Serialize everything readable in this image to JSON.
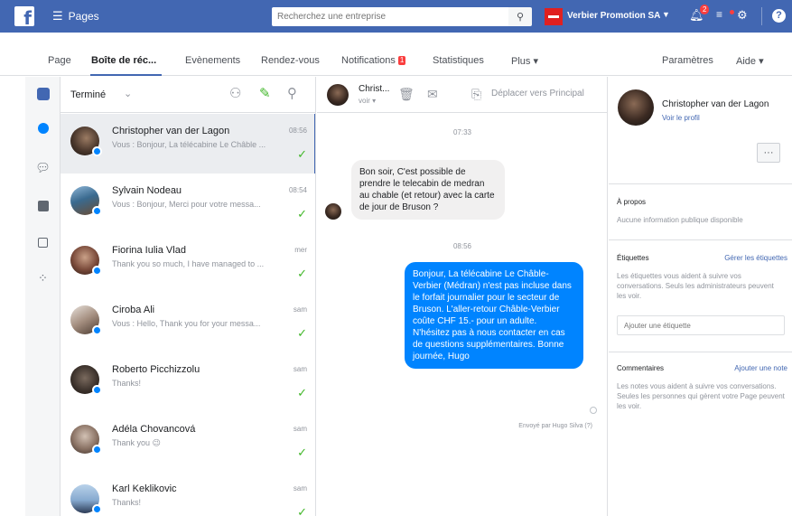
{
  "topbar": {
    "pages_label": "Pages",
    "search_placeholder": "Recherchez une entreprise",
    "page_name": "Verbier Promotion SA",
    "notif_count": "2",
    "help_icon": "question-icon"
  },
  "tabs": [
    {
      "label": "Page"
    },
    {
      "label": "Boîte de réc..."
    },
    {
      "label": "Evènements"
    },
    {
      "label": "Rendez-vous"
    },
    {
      "label": "Notifications"
    },
    {
      "label": "Statistiques"
    },
    {
      "label": "Plus ▾"
    },
    {
      "label": "Paramètres"
    },
    {
      "label": "Aide ▾"
    }
  ],
  "tab_notif_badge": "1",
  "list": {
    "filter_label": "Terminé",
    "conversations": [
      {
        "name": "Christopher van der Lagon",
        "preview": "Vous : Bonjour, La télécabine Le Châble ...",
        "time": "08:56"
      },
      {
        "name": "Sylvain Nodeau",
        "preview": "Vous : Bonjour, Merci pour votre messa...",
        "time": "08:54"
      },
      {
        "name": "Fiorina Iulia Vlad",
        "preview": "Thank you so much, I have managed to ...",
        "time": "mer"
      },
      {
        "name": "Ciroba Ali",
        "preview": "Vous : Hello, Thank you for your messa...",
        "time": "sam"
      },
      {
        "name": "Roberto Picchizzolu",
        "preview": "Thanks!",
        "time": "sam"
      },
      {
        "name": "Adéla Chovancová",
        "preview": "Thank you 😉",
        "time": "sam"
      },
      {
        "name": "Karl Keklikovic",
        "preview": "Thanks!",
        "time": "sam"
      }
    ]
  },
  "chat": {
    "contact_name": "Christ...",
    "contact_sub": "voir ▾",
    "move_label": "Déplacer vers Principal",
    "time1": "07:33",
    "incoming": "Bon soir, C'est possible de prendre le telecabin de medran au chable (et retour) avec la carte de jour de Bruson ?",
    "time2": "08:56",
    "outgoing": "Bonjour, La télécabine Le Châble-Verbier (Médran) n'est pas incluse dans le forfait journalier pour le secteur de Bruson. L'aller-retour Châble-Verbier coûte CHF 15.- pour un adulte. N'hésitez pas à nous contacter en cas de questions supplémentaires. Bonne journée, Hugo",
    "sent_by": "Envoyé par Hugo Silva (?)"
  },
  "profile": {
    "name": "Christopher van der Lagon",
    "profile_link": "Voir le profil",
    "more_label": "···",
    "about_title": "À propos",
    "about_text": "Aucune information publique disponible",
    "labels_title": "Étiquettes",
    "labels_link": "Gérer les étiquettes",
    "labels_text": "Les étiquettes vous aident à suivre vos conversations. Seuls les administrateurs peuvent les voir.",
    "labels_input": "Ajouter une étiquette",
    "comments_title": "Commentaires",
    "comments_link": "Ajouter une note",
    "comments_text": "Les notes vous aident à suivre vos conversations. Seules les personnes qui gèrent votre Page peuvent les voir."
  },
  "colors": {
    "brand": "#4267b2",
    "messenger": "#0084ff",
    "check": "#42b72a",
    "alert": "#fa3e3e"
  }
}
